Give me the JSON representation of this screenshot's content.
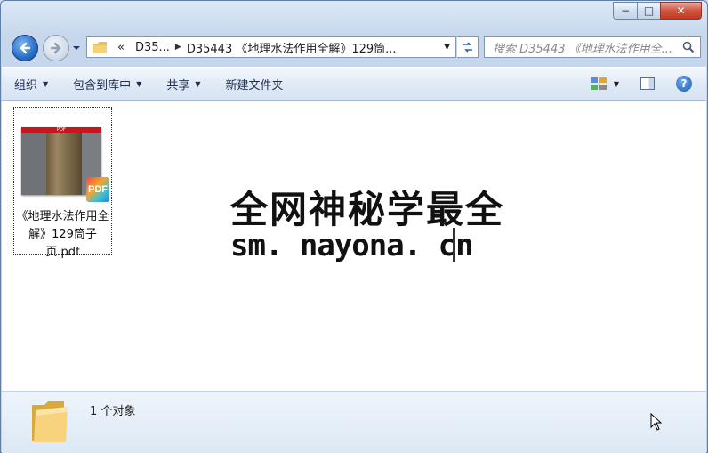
{
  "window": {
    "caption": {
      "minimize": "−",
      "maximize": "□",
      "close": "✕"
    }
  },
  "address": {
    "overflow": "«",
    "crumbs": [
      "D35...",
      "D35443 《地理水法作用全解》129筒..."
    ],
    "search_placeholder": "搜索 D35443 《地理水法作用全..."
  },
  "toolbar": {
    "organize": "组织",
    "include_library": "包含到库中",
    "share": "共享",
    "new_folder": "新建文件夹",
    "help": "?"
  },
  "files": [
    {
      "name": "《地理水法作用全解》129筒子页.pdf",
      "badge": "PDF",
      "thumb_label": "PDF"
    }
  ],
  "watermark": {
    "line1": "全网神秘学最全",
    "line2": "sm. nayona. cn"
  },
  "status": {
    "count_text": "1 个对象"
  },
  "icons": [
    "back-arrow-icon",
    "forward-arrow-icon",
    "folder-icon",
    "refresh-icon",
    "search-icon",
    "view-options-icon",
    "preview-pane-icon",
    "help-icon",
    "pdf-file-icon",
    "mouse-cursor-icon"
  ]
}
